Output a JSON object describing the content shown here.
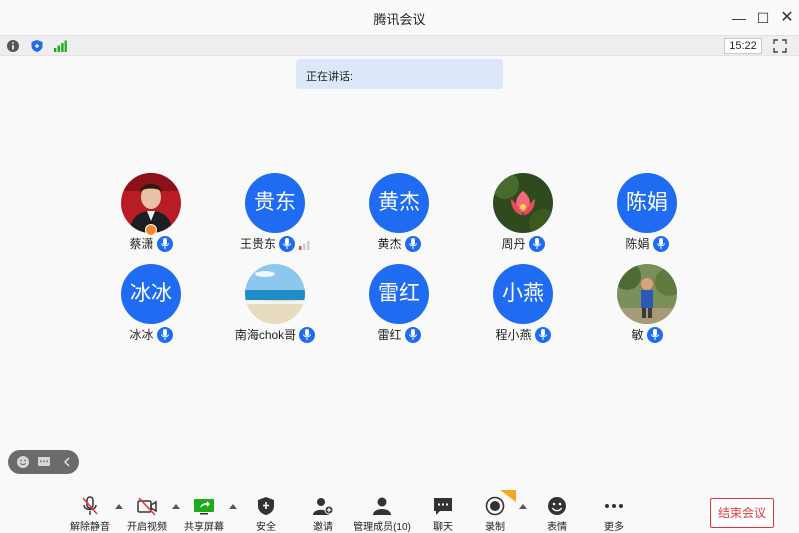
{
  "window": {
    "title": "腾讯会议",
    "min_symbol": "—",
    "max_symbol": "☐",
    "close_symbol": "✕"
  },
  "statusbar": {
    "icons": [
      "info-icon",
      "shield-icon",
      "signal-icon"
    ],
    "clock": "15:22"
  },
  "speaking": {
    "label": "正在讲话:"
  },
  "participants": [
    {
      "name": "蔡潇",
      "avatar_type": "photo-person",
      "host": true
    },
    {
      "name": "王贵东",
      "avatar_text": "贵东",
      "signal": true
    },
    {
      "name": "黄杰",
      "avatar_text": "黄杰"
    },
    {
      "name": "周丹",
      "avatar_type": "photo-lotus"
    },
    {
      "name": "陈娟",
      "avatar_text": "陈娟"
    },
    {
      "name": "冰冰",
      "avatar_text": "冰冰"
    },
    {
      "name": "南海chok哥",
      "avatar_type": "photo-beach"
    },
    {
      "name": "雷红",
      "avatar_text": "雷红"
    },
    {
      "name": "程小燕",
      "avatar_text": "小燕"
    },
    {
      "name": "敏",
      "avatar_type": "photo-outdoor"
    }
  ],
  "toolbar": {
    "unmute": "解除静音",
    "video": "开启视频",
    "share": "共享屏幕",
    "security": "安全",
    "invite": "邀请",
    "members": "管理成员(10)",
    "chat": "聊天",
    "record": "录制",
    "reactions": "表情",
    "more": "更多",
    "end": "结束会议"
  },
  "colors": {
    "accent": "#1f6cf2",
    "danger": "#e0393e",
    "host": "#f08a24"
  }
}
